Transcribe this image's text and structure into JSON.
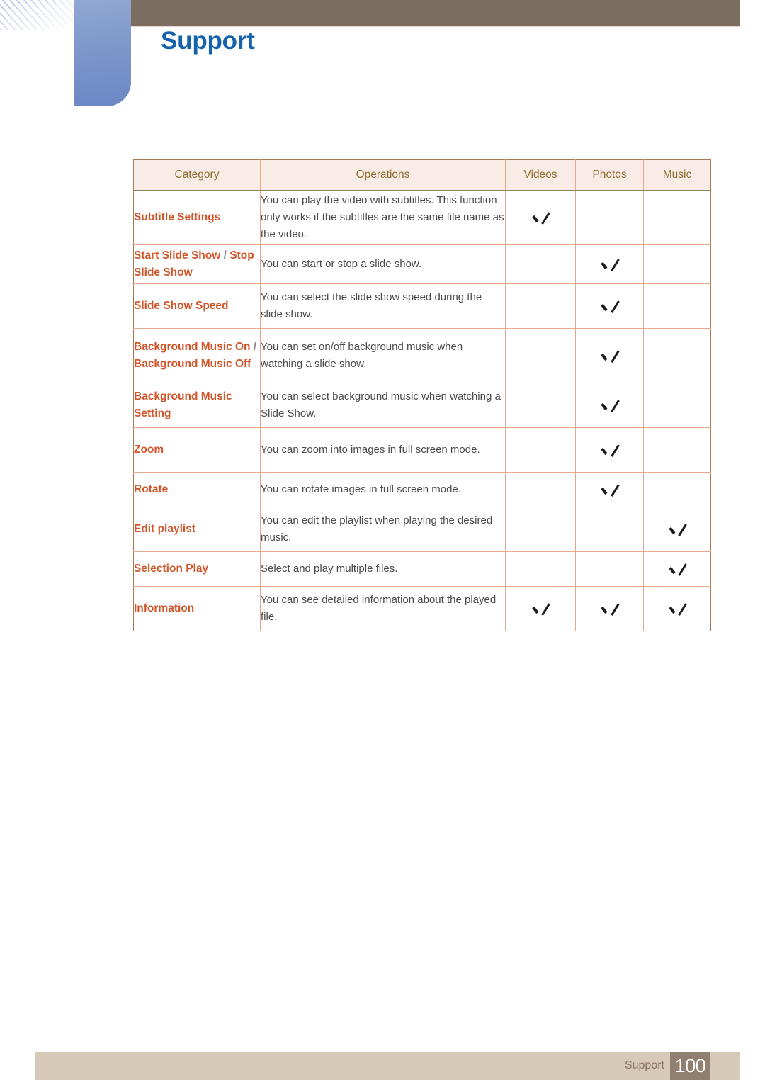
{
  "header": {
    "section_title": "Support",
    "accent_blue": "#1463ab",
    "tab_blue": "#7e97cb",
    "bar_brown": "#7b6d5f"
  },
  "colors": {
    "table_header_bg": "#f9ece7",
    "table_header_text": "#8c6e2e",
    "category_text": "#d2552a",
    "body_text": "#4a4a4a",
    "table_border": "#e0a98b",
    "outer_border": "#a97a4e",
    "footer_bar": "#d6c9b8",
    "footer_page_box": "#91806f"
  },
  "table": {
    "columns": [
      "Category",
      "Operations",
      "Videos",
      "Photos",
      "Music"
    ],
    "rows": [
      {
        "category": "Subtitle Settings",
        "category_parts": [
          "Subtitle Settings"
        ],
        "operations": "You can play the video with subtitles. This function only works if the subtitles are the same file name as the video.",
        "videos": true,
        "photos": false,
        "music": false
      },
      {
        "category": "Start Slide Show / Stop Slide Show",
        "category_parts": [
          "Start Slide Show",
          "Stop Slide Show"
        ],
        "operations": "You can start or stop a slide show.",
        "videos": false,
        "photos": true,
        "music": false
      },
      {
        "category": "Slide Show Speed",
        "category_parts": [
          "Slide Show Speed"
        ],
        "operations": "You can select the slide show speed during the slide show.",
        "videos": false,
        "photos": true,
        "music": false
      },
      {
        "category": "Background Music On / Background Music Off",
        "category_parts": [
          "Background Music On",
          "Background Music Off"
        ],
        "operations": "You can set on/off background music when watching a slide show.",
        "videos": false,
        "photos": true,
        "music": false
      },
      {
        "category": "Background Music Setting",
        "category_parts": [
          "Background Music Setting"
        ],
        "operations": "You can select background music when watching a Slide Show.",
        "videos": false,
        "photos": true,
        "music": false
      },
      {
        "category": "Zoom",
        "category_parts": [
          "Zoom"
        ],
        "operations": "You can zoom into images in full screen mode.",
        "videos": false,
        "photos": true,
        "music": false
      },
      {
        "category": "Rotate",
        "category_parts": [
          "Rotate"
        ],
        "operations": "You can rotate images in full screen mode.",
        "videos": false,
        "photos": true,
        "music": false
      },
      {
        "category": "Edit playlist",
        "category_parts": [
          "Edit playlist"
        ],
        "operations": "You can edit the playlist when playing the desired music.",
        "videos": false,
        "photos": false,
        "music": true
      },
      {
        "category": "Selection Play",
        "category_parts": [
          "Selection Play"
        ],
        "operations": "Select and play multiple files.",
        "videos": false,
        "photos": false,
        "music": true
      },
      {
        "category": "Information",
        "category_parts": [
          "Information"
        ],
        "operations": "You can see detailed information about the played file.",
        "videos": true,
        "photos": true,
        "music": true
      }
    ]
  },
  "footer": {
    "label": "Support",
    "page_number": "100"
  },
  "icons": {
    "check": "check-icon"
  }
}
